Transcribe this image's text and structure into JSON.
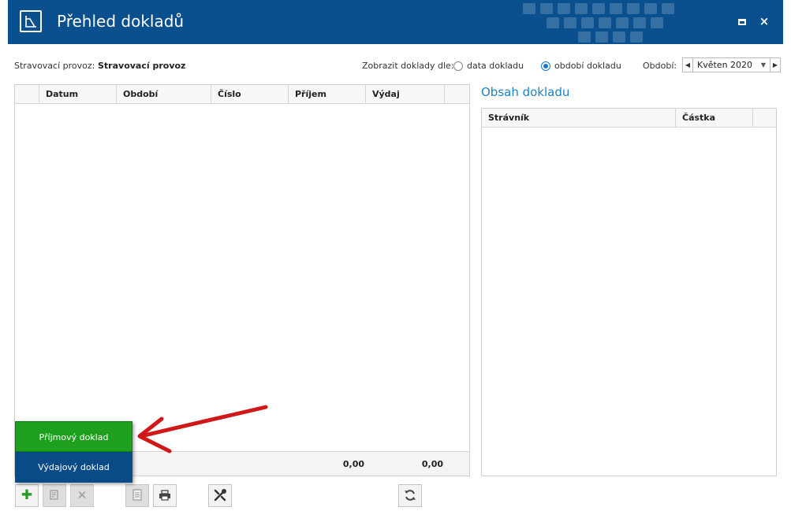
{
  "window": {
    "title": "Přehled dokladů",
    "accent_color": "#0a4f8e",
    "max_glyph": "maximize-icon",
    "close_glyph": "×"
  },
  "filter": {
    "provoz_label": "Stravovací provoz:",
    "provoz_value": "Stravovací provoz",
    "zobrazit_label": "Zobrazit doklady dle:",
    "options": [
      {
        "label": "data dokladu",
        "checked": false
      },
      {
        "label": "období dokladu",
        "checked": true
      }
    ],
    "obdobi_label": "Období:",
    "obdobi_value": "Květen 2020"
  },
  "documents_grid": {
    "columns": [
      "Datum",
      "Období",
      "Číslo",
      "Příjem",
      "Výdaj"
    ],
    "rows": [],
    "totals": {
      "prijem": "0,00",
      "vydaj": "0,00"
    }
  },
  "content_panel": {
    "title": "Obsah dokladu",
    "columns": [
      "Strávník",
      "Částka"
    ],
    "rows": []
  },
  "toolbar": {
    "buttons": [
      {
        "name": "add-button",
        "icon": "plus-icon",
        "enabled": true
      },
      {
        "name": "edit-button",
        "icon": "edit-icon",
        "enabled": false
      },
      {
        "name": "delete-button",
        "icon": "delete-icon",
        "enabled": false
      },
      {
        "name": "document-button",
        "icon": "document-icon",
        "enabled": false
      },
      {
        "name": "print-button",
        "icon": "print-icon",
        "enabled": true
      },
      {
        "name": "tools-button",
        "icon": "tools-icon",
        "enabled": true
      },
      {
        "name": "refresh-button",
        "icon": "refresh-icon",
        "enabled": true
      }
    ]
  },
  "add_menu": {
    "items": [
      {
        "label": "Příjmový doklad",
        "highlight": true,
        "color": "#1ea01e"
      },
      {
        "label": "Výdajový doklad",
        "highlight": false,
        "color": "#0a4a86"
      }
    ]
  },
  "annotation": {
    "arrow_color": "#d01818"
  }
}
